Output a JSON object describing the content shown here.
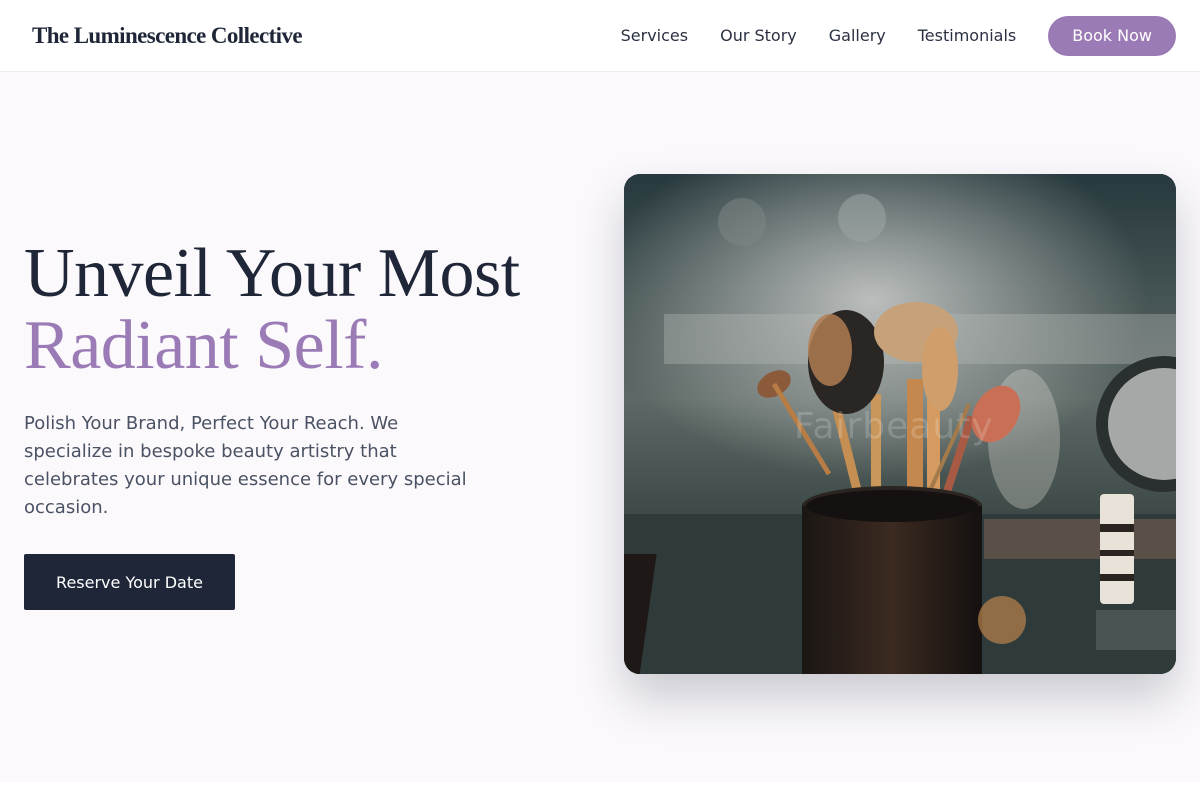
{
  "header": {
    "brand": "The Luminescence Collective",
    "nav": [
      "Services",
      "Our Story",
      "Gallery",
      "Testimonials"
    ],
    "book_label": "Book Now"
  },
  "hero": {
    "headline_line1": "Unveil Your Most",
    "headline_line2": "Radiant Self.",
    "subtitle": "Polish Your Brand, Perfect Your Reach. We specialize in bespoke beauty artistry that celebrates your unique essence for every special occasion.",
    "cta_label": "Reserve Your Date",
    "image_watermark": "Fairbeauty"
  },
  "colors": {
    "accent": "#9a7bb5",
    "dark": "#1e2638",
    "background": "#fbf9fc"
  }
}
